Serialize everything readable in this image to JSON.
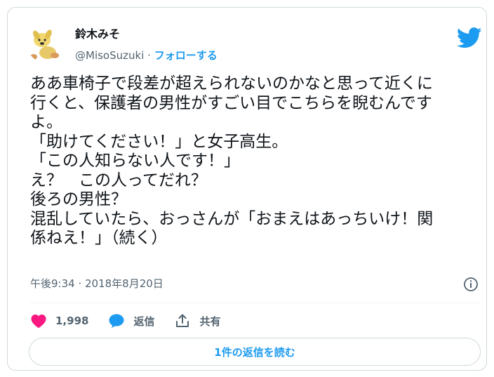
{
  "author": {
    "display_name": "鈴木みそ",
    "handle": "@MisoSuzuki",
    "separator": "·",
    "follow_label": "フォローする"
  },
  "tweet": {
    "lines": [
      "ああ車椅子で段差が超えられないのかなと思って近くに",
      "行くと、保護者の男性がすごい目でこちらを睨むんです",
      "よ。",
      "「助けてください！」と女子高生。",
      "「この人知らない人です！」",
      "え？　この人ってだれ？",
      "後ろの男性？",
      "混乱していたら、おっさんが「おまえはあっちいけ！関",
      "係ねえ！」（続く）"
    ],
    "timestamp": "午後9:34 · 2018年8月20日"
  },
  "actions": {
    "like_count": "1,998",
    "reply_label": "返信",
    "share_label": "共有"
  },
  "read_replies_label": "1件の返信を読む",
  "colors": {
    "accent": "#1d9bf0",
    "like": "#f91880",
    "text": "#0f1419",
    "secondary": "#536471",
    "border": "#cfd9de"
  },
  "icons": {
    "logo": "twitter-bird-icon",
    "info": "info-icon",
    "like": "heart-icon",
    "reply": "speech-bubble-icon",
    "share": "share-upload-icon"
  }
}
